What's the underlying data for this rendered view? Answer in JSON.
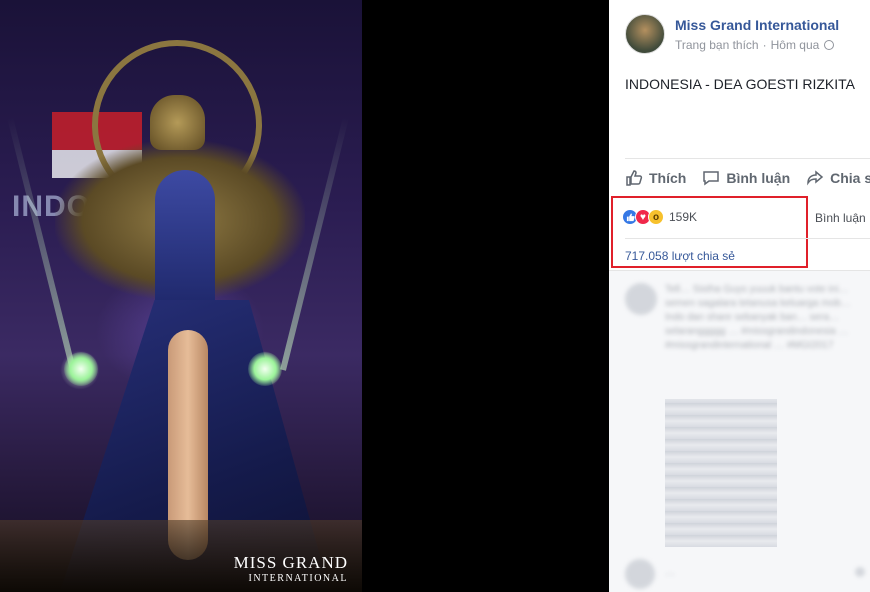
{
  "photo": {
    "screen_text": "INDO",
    "logo_line1": "MISS GRAND",
    "logo_line2": "INTERNATIONAL"
  },
  "post": {
    "page_name": "Miss Grand International",
    "audience": "Trang bạn thích",
    "separator": "·",
    "time": "Hôm qua",
    "text": "INDONESIA - DEA GOESTI RIZKITA"
  },
  "actions": {
    "like": "Thích",
    "comment": "Bình luận",
    "share": "Chia sẻ"
  },
  "stats": {
    "reaction_count": "159K",
    "comments_label": "Bình luận",
    "shares": "717.058 lượt chia sẻ"
  },
  "comments": {
    "first_text": "Tell… Sistha Guys yuuuk bantu vote ini… semen sagalara tetanusa keluarga mob… Indo dan share sebanyak ban… sera… selaranggggg … #missgrandindonesia … #missgrandinternational … #MGI2017",
    "second_text": "…"
  },
  "colors": {
    "link": "#365899",
    "highlight_box": "#e0202a",
    "like": "#3578e5",
    "love": "#f0284a",
    "wow": "#f7c12d"
  }
}
